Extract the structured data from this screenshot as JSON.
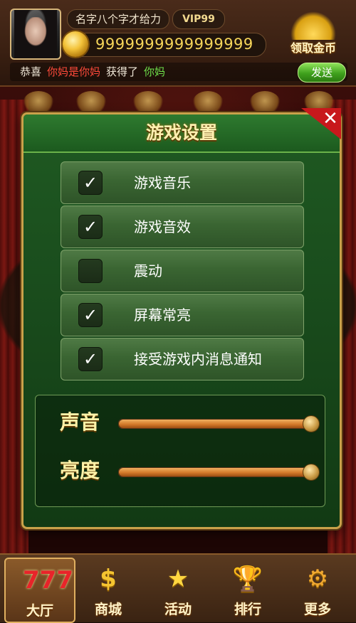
{
  "header": {
    "username": "名字八个字才给力",
    "vip": "VIP99",
    "coins": "9999999999999999",
    "gold_button_label": "领取金币"
  },
  "broadcast": {
    "prefix": "恭喜",
    "user": "你妈是你妈",
    "verb": "获得了",
    "item": "你妈",
    "send_label": "发送"
  },
  "dialog": {
    "title": "游戏设置",
    "close_label": "✕",
    "options": [
      {
        "label": "游戏音乐",
        "checked": true
      },
      {
        "label": "游戏音效",
        "checked": true
      },
      {
        "label": "震动",
        "checked": false
      },
      {
        "label": "屏幕常亮",
        "checked": true
      },
      {
        "label": "接受游戏内消息通知",
        "checked": true
      }
    ],
    "sliders": [
      {
        "label": "声音",
        "value": 1.0
      },
      {
        "label": "亮度",
        "value": 1.0
      }
    ]
  },
  "bottom_nav": [
    {
      "label": "大厅",
      "icon": "slot-777-icon",
      "active": true
    },
    {
      "label": "商城",
      "icon": "dollar-icon",
      "active": false
    },
    {
      "label": "活动",
      "icon": "stars-icon",
      "active": false
    },
    {
      "label": "排行",
      "icon": "trophy-icon",
      "active": false
    },
    {
      "label": "更多",
      "icon": "gear-icon",
      "active": false
    }
  ],
  "colors": {
    "accent_gold": "#f6d65a",
    "dialog_green": "#1a4d1d",
    "close_red": "#c8181c"
  }
}
